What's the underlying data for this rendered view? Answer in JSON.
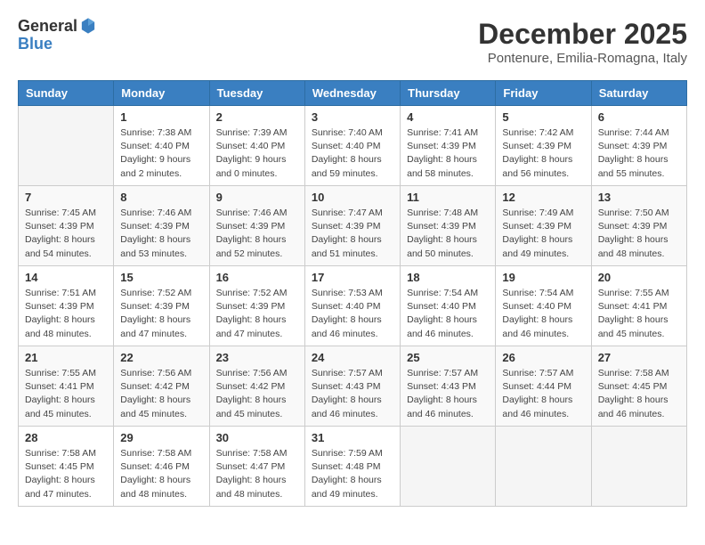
{
  "logo": {
    "general": "General",
    "blue": "Blue"
  },
  "title": "December 2025",
  "location": "Pontenure, Emilia-Romagna, Italy",
  "days_of_week": [
    "Sunday",
    "Monday",
    "Tuesday",
    "Wednesday",
    "Thursday",
    "Friday",
    "Saturday"
  ],
  "weeks": [
    [
      {
        "day": "",
        "empty": true
      },
      {
        "day": "1",
        "sunrise": "7:38 AM",
        "sunset": "4:40 PM",
        "daylight": "9 hours and 2 minutes."
      },
      {
        "day": "2",
        "sunrise": "7:39 AM",
        "sunset": "4:40 PM",
        "daylight": "9 hours and 0 minutes."
      },
      {
        "day": "3",
        "sunrise": "7:40 AM",
        "sunset": "4:40 PM",
        "daylight": "8 hours and 59 minutes."
      },
      {
        "day": "4",
        "sunrise": "7:41 AM",
        "sunset": "4:39 PM",
        "daylight": "8 hours and 58 minutes."
      },
      {
        "day": "5",
        "sunrise": "7:42 AM",
        "sunset": "4:39 PM",
        "daylight": "8 hours and 56 minutes."
      },
      {
        "day": "6",
        "sunrise": "7:44 AM",
        "sunset": "4:39 PM",
        "daylight": "8 hours and 55 minutes."
      }
    ],
    [
      {
        "day": "7",
        "sunrise": "7:45 AM",
        "sunset": "4:39 PM",
        "daylight": "8 hours and 54 minutes."
      },
      {
        "day": "8",
        "sunrise": "7:46 AM",
        "sunset": "4:39 PM",
        "daylight": "8 hours and 53 minutes."
      },
      {
        "day": "9",
        "sunrise": "7:46 AM",
        "sunset": "4:39 PM",
        "daylight": "8 hours and 52 minutes."
      },
      {
        "day": "10",
        "sunrise": "7:47 AM",
        "sunset": "4:39 PM",
        "daylight": "8 hours and 51 minutes."
      },
      {
        "day": "11",
        "sunrise": "7:48 AM",
        "sunset": "4:39 PM",
        "daylight": "8 hours and 50 minutes."
      },
      {
        "day": "12",
        "sunrise": "7:49 AM",
        "sunset": "4:39 PM",
        "daylight": "8 hours and 49 minutes."
      },
      {
        "day": "13",
        "sunrise": "7:50 AM",
        "sunset": "4:39 PM",
        "daylight": "8 hours and 48 minutes."
      }
    ],
    [
      {
        "day": "14",
        "sunrise": "7:51 AM",
        "sunset": "4:39 PM",
        "daylight": "8 hours and 48 minutes."
      },
      {
        "day": "15",
        "sunrise": "7:52 AM",
        "sunset": "4:39 PM",
        "daylight": "8 hours and 47 minutes."
      },
      {
        "day": "16",
        "sunrise": "7:52 AM",
        "sunset": "4:39 PM",
        "daylight": "8 hours and 47 minutes."
      },
      {
        "day": "17",
        "sunrise": "7:53 AM",
        "sunset": "4:40 PM",
        "daylight": "8 hours and 46 minutes."
      },
      {
        "day": "18",
        "sunrise": "7:54 AM",
        "sunset": "4:40 PM",
        "daylight": "8 hours and 46 minutes."
      },
      {
        "day": "19",
        "sunrise": "7:54 AM",
        "sunset": "4:40 PM",
        "daylight": "8 hours and 46 minutes."
      },
      {
        "day": "20",
        "sunrise": "7:55 AM",
        "sunset": "4:41 PM",
        "daylight": "8 hours and 45 minutes."
      }
    ],
    [
      {
        "day": "21",
        "sunrise": "7:55 AM",
        "sunset": "4:41 PM",
        "daylight": "8 hours and 45 minutes."
      },
      {
        "day": "22",
        "sunrise": "7:56 AM",
        "sunset": "4:42 PM",
        "daylight": "8 hours and 45 minutes."
      },
      {
        "day": "23",
        "sunrise": "7:56 AM",
        "sunset": "4:42 PM",
        "daylight": "8 hours and 45 minutes."
      },
      {
        "day": "24",
        "sunrise": "7:57 AM",
        "sunset": "4:43 PM",
        "daylight": "8 hours and 46 minutes."
      },
      {
        "day": "25",
        "sunrise": "7:57 AM",
        "sunset": "4:43 PM",
        "daylight": "8 hours and 46 minutes."
      },
      {
        "day": "26",
        "sunrise": "7:57 AM",
        "sunset": "4:44 PM",
        "daylight": "8 hours and 46 minutes."
      },
      {
        "day": "27",
        "sunrise": "7:58 AM",
        "sunset": "4:45 PM",
        "daylight": "8 hours and 46 minutes."
      }
    ],
    [
      {
        "day": "28",
        "sunrise": "7:58 AM",
        "sunset": "4:45 PM",
        "daylight": "8 hours and 47 minutes."
      },
      {
        "day": "29",
        "sunrise": "7:58 AM",
        "sunset": "4:46 PM",
        "daylight": "8 hours and 48 minutes."
      },
      {
        "day": "30",
        "sunrise": "7:58 AM",
        "sunset": "4:47 PM",
        "daylight": "8 hours and 48 minutes."
      },
      {
        "day": "31",
        "sunrise": "7:59 AM",
        "sunset": "4:48 PM",
        "daylight": "8 hours and 49 minutes."
      },
      {
        "day": "",
        "empty": true
      },
      {
        "day": "",
        "empty": true
      },
      {
        "day": "",
        "empty": true
      }
    ]
  ]
}
